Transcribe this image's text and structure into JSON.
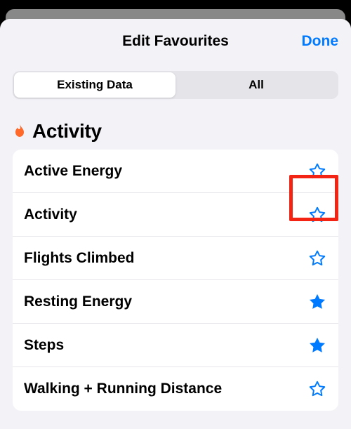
{
  "header": {
    "title": "Edit Favourites",
    "done": "Done"
  },
  "segmented": {
    "existing": "Existing Data",
    "all": "All"
  },
  "section": {
    "title": "Activity"
  },
  "rows": {
    "r0": {
      "label": "Active Energy",
      "fav": false
    },
    "r1": {
      "label": "Activity",
      "fav": false
    },
    "r2": {
      "label": "Flights Climbed",
      "fav": false
    },
    "r3": {
      "label": "Resting Energy",
      "fav": true
    },
    "r4": {
      "label": "Steps",
      "fav": true
    },
    "r5": {
      "label": "Walking + Running Distance",
      "fav": false
    }
  },
  "colors": {
    "accent": "#007aff",
    "flame": "#ff6a2b"
  }
}
